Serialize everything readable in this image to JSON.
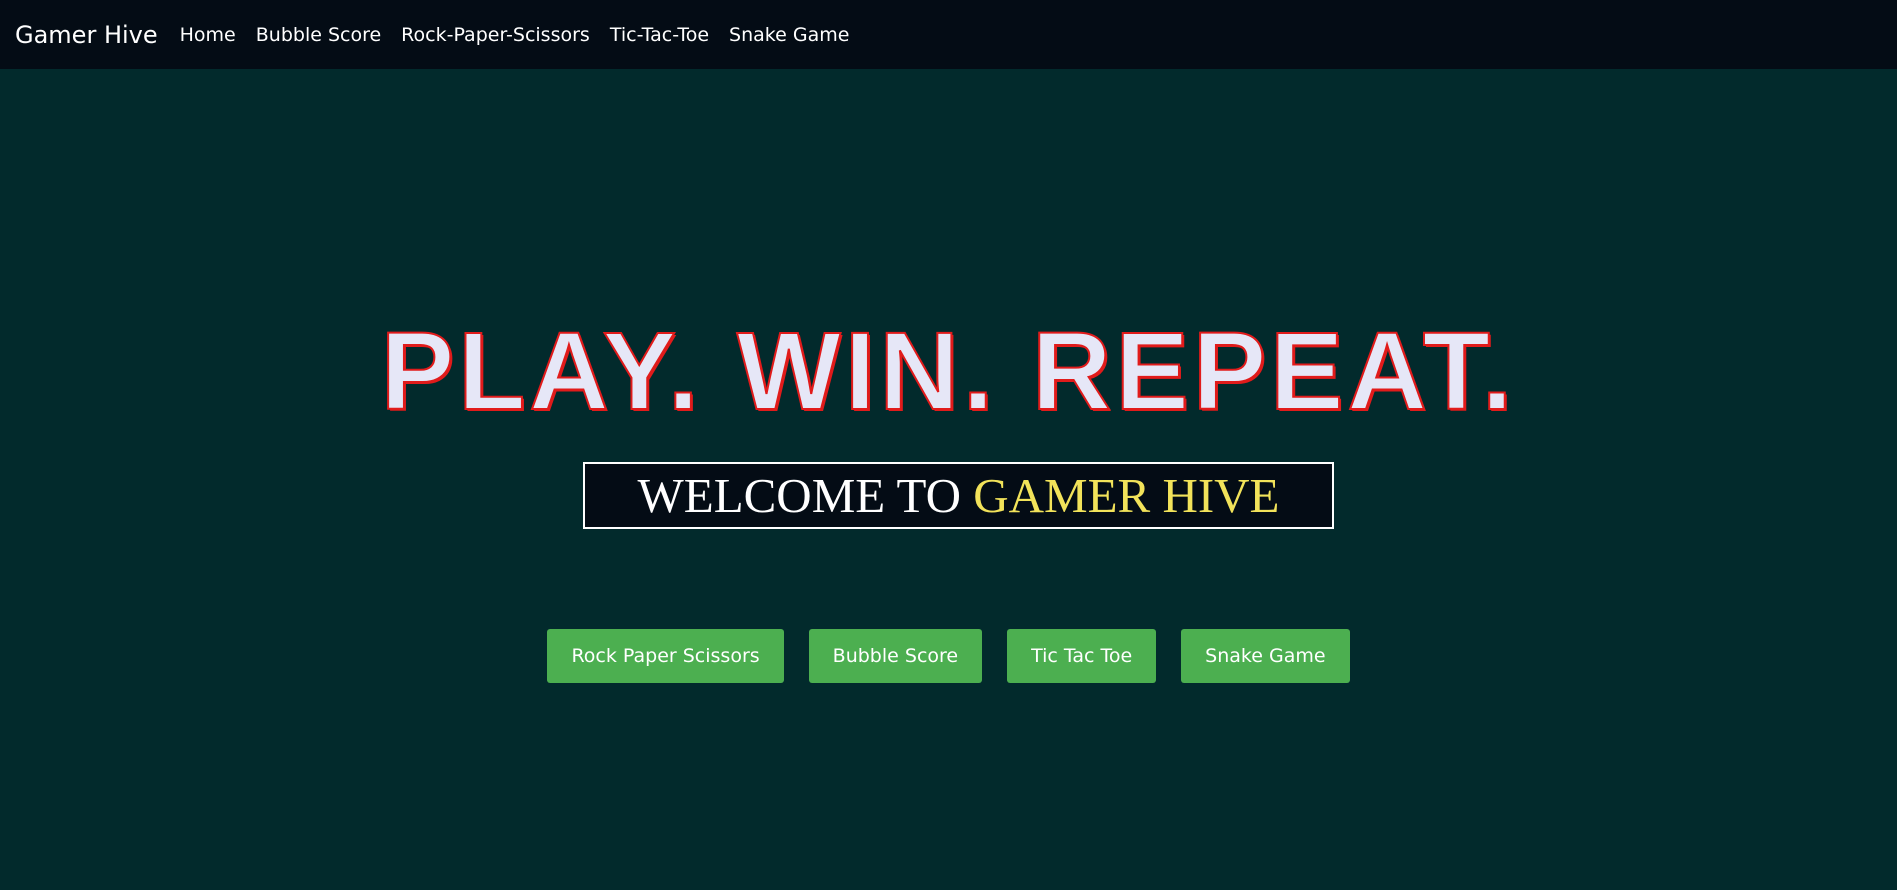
{
  "navbar": {
    "brand": "Gamer Hive",
    "links": [
      {
        "label": "Home"
      },
      {
        "label": "Bubble Score"
      },
      {
        "label": "Rock-Paper-Scissors"
      },
      {
        "label": "Tic-Tac-Toe"
      },
      {
        "label": "Snake Game"
      }
    ]
  },
  "hero": {
    "title": "PLAY. WIN. REPEAT.",
    "welcome_prefix": "WELCOME TO ",
    "welcome_name": "GAMER HIVE"
  },
  "buttons": [
    {
      "label": "Rock Paper Scissors"
    },
    {
      "label": "Bubble Score"
    },
    {
      "label": "Tic Tac Toe"
    },
    {
      "label": "Snake Game"
    }
  ],
  "colors": {
    "page_background": "#022a2c",
    "navbar_background": "#040c15",
    "title_fill": "#e6e7f7",
    "title_outline": "#e11b1b",
    "welcome_accent": "#f2e35a",
    "button_green": "#4caf50"
  }
}
